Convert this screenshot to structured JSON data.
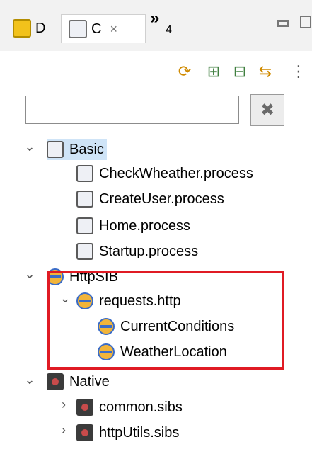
{
  "tabs": [
    {
      "label": "D",
      "icon": "yellow-square-icon"
    },
    {
      "label": "C",
      "icon": "process-icon",
      "close_icon": "×"
    }
  ],
  "overflow": {
    "chevron": "»",
    "count": "4"
  },
  "toolbar": {
    "refresh": "⟳",
    "expand": "⊞",
    "collapse": "⊟",
    "sync": "⇆",
    "menu": "⋮"
  },
  "search": {
    "value": "",
    "placeholder": ""
  },
  "clear_button": {
    "glyph": "✖"
  },
  "tree": [
    {
      "label": "Basic",
      "icon": "process-icon",
      "twisty": "⌄",
      "selected": true
    },
    {
      "label": "CheckWheather.process",
      "icon": "process-icon"
    },
    {
      "label": "CreateUser.process",
      "icon": "process-icon"
    },
    {
      "label": "Home.process",
      "icon": "process-icon"
    },
    {
      "label": "Startup.process",
      "icon": "process-icon"
    },
    {
      "label": "HttpSIB",
      "icon": "sib-icon",
      "twisty": "⌄"
    },
    {
      "label": "requests.http",
      "icon": "sib-icon",
      "twisty": "⌄"
    },
    {
      "label": "CurrentConditions",
      "icon": "sib-icon"
    },
    {
      "label": "WeatherLocation",
      "icon": "sib-icon"
    },
    {
      "label": "Native",
      "icon": "native-icon",
      "twisty": "⌄"
    },
    {
      "label": "common.sibs",
      "icon": "native-icon",
      "twisty": "›"
    },
    {
      "label": "httpUtils.sibs",
      "icon": "native-icon",
      "twisty": "›"
    }
  ],
  "colors": {
    "highlight": "#e01b24",
    "selection": "#cfe4f7",
    "tabbar": "#f2f2f2"
  }
}
